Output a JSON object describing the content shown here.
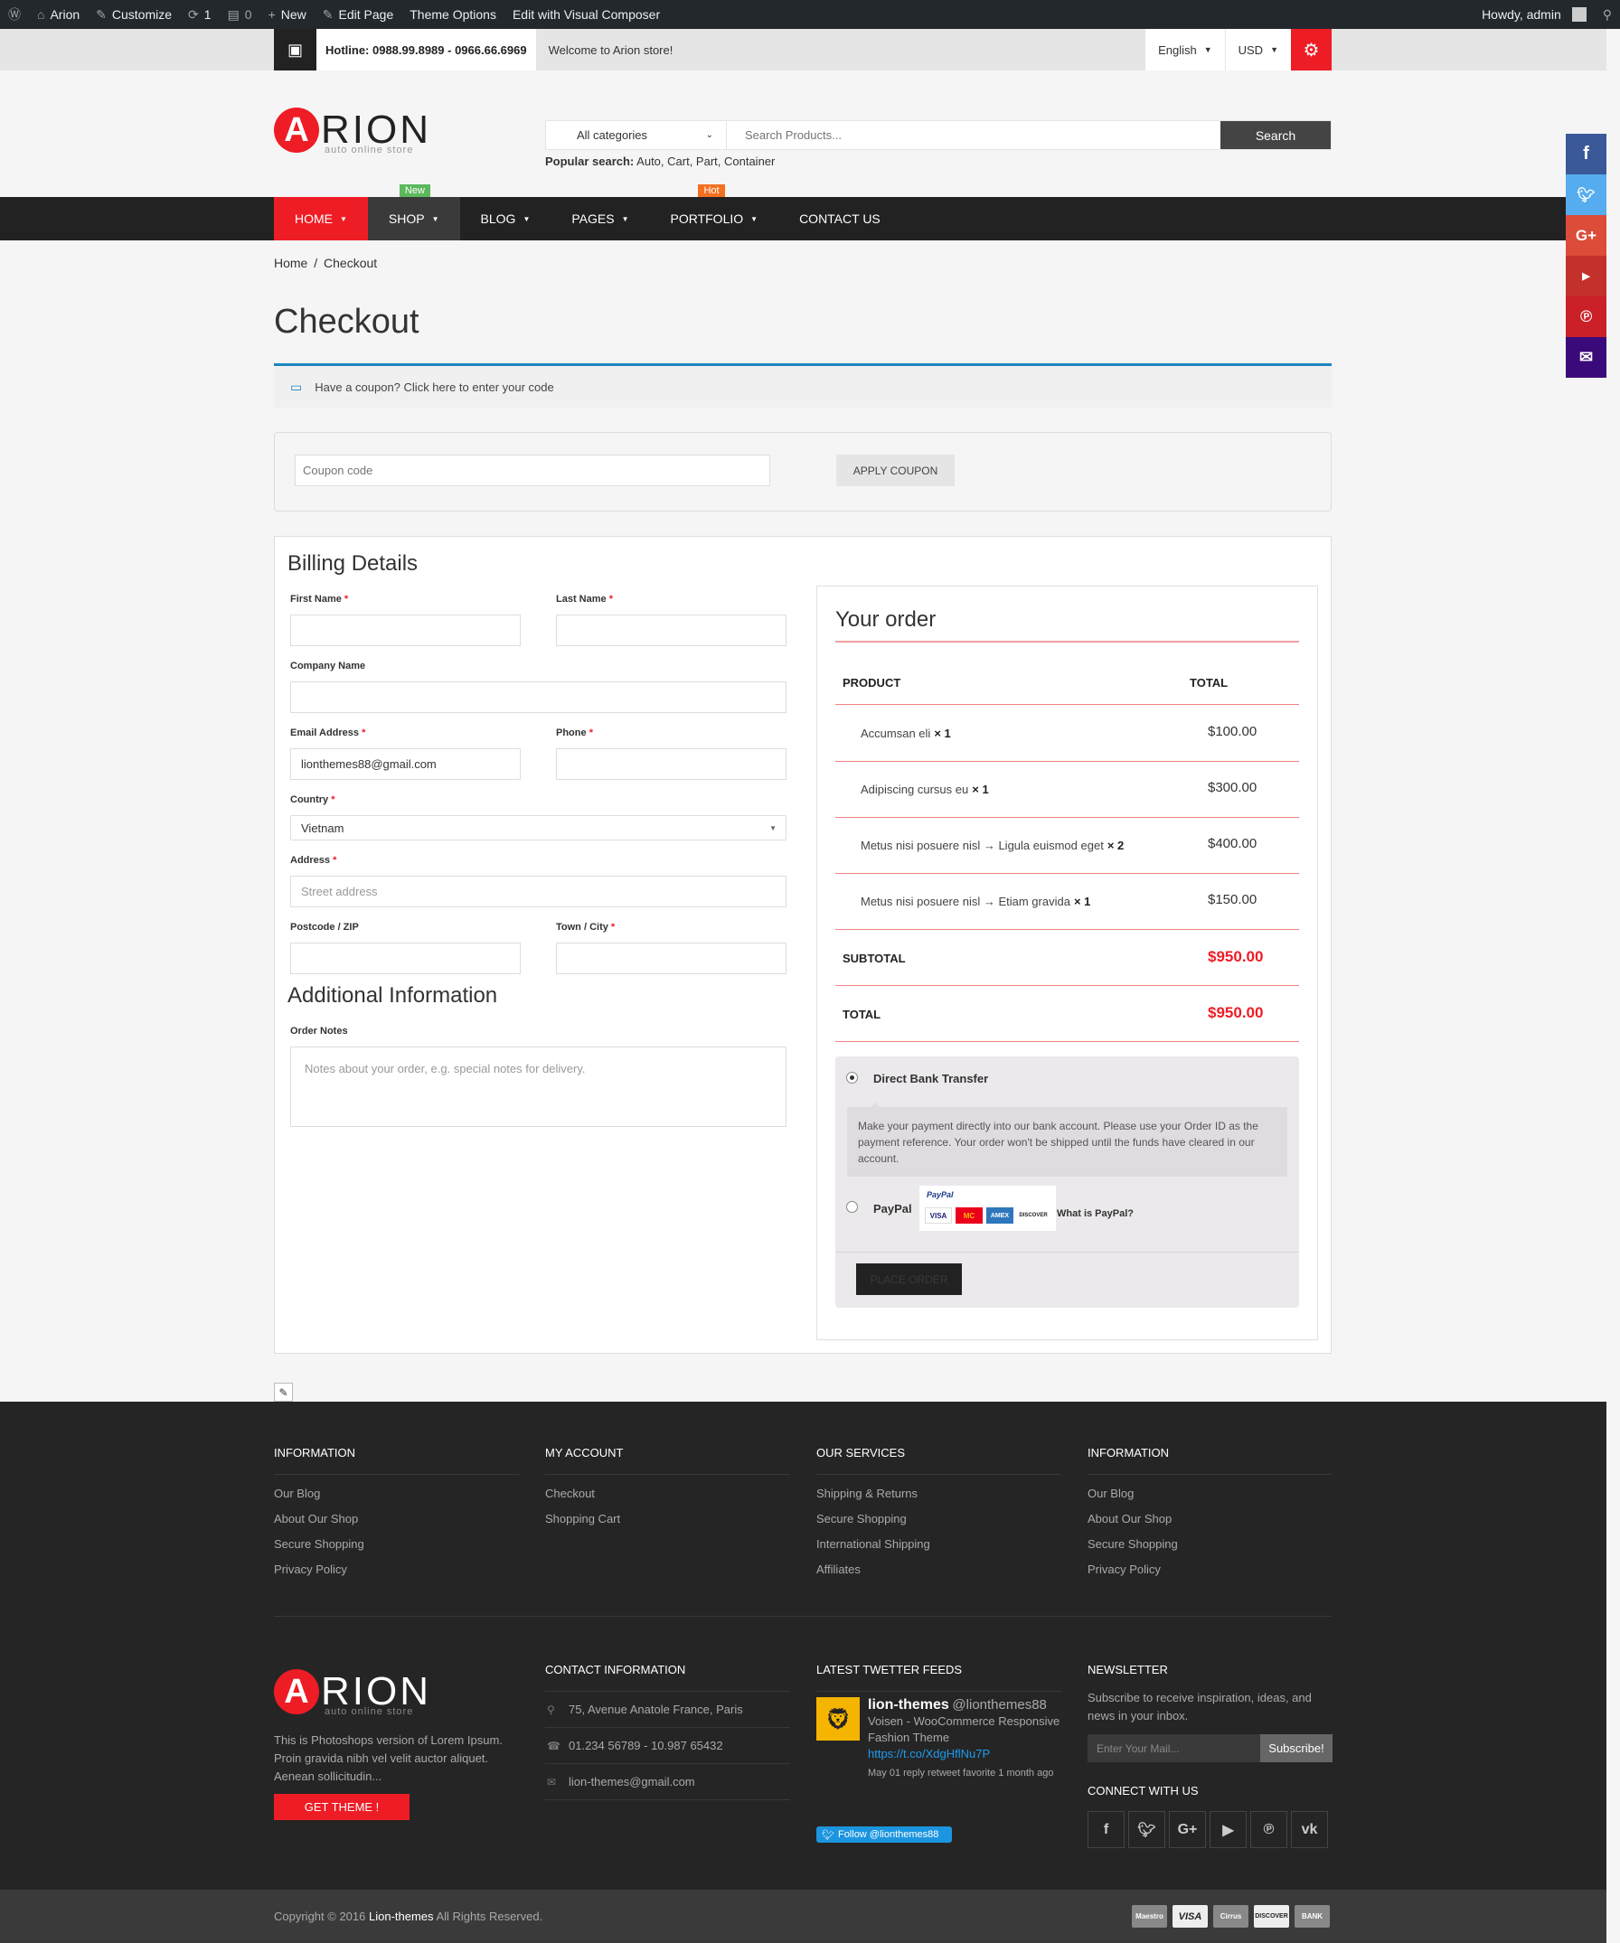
{
  "admin_bar": {
    "site_name": "Arion",
    "customize": "Customize",
    "updates_count": "1",
    "comments_count": "0",
    "new": "New",
    "edit_page": "Edit Page",
    "theme_options": "Theme Options",
    "edit_vc": "Edit with Visual Composer",
    "greeting": "Howdy, admin"
  },
  "topbar": {
    "hotline": "Hotline: 0988.99.8989 - 0966.66.6969",
    "welcome": "Welcome to Arion store!",
    "language": "English",
    "currency": "USD"
  },
  "header": {
    "logo_letter": "A",
    "logo_word": "RION",
    "logo_tagline": "auto online store",
    "search_category": "All categories",
    "search_placeholder": "Search Products...",
    "search_button": "Search",
    "popular_label": "Popular search:",
    "popular_terms": "Auto, Cart, Part, Container"
  },
  "nav": {
    "items": [
      {
        "label": "HOME",
        "badge": ""
      },
      {
        "label": "SHOP",
        "badge": "New"
      },
      {
        "label": "BLOG",
        "badge": ""
      },
      {
        "label": "PAGES",
        "badge": ""
      },
      {
        "label": "PORTFOLIO",
        "badge": "Hot"
      },
      {
        "label": "CONTACT US",
        "badge": ""
      }
    ]
  },
  "breadcrumb": {
    "home": "Home",
    "separator": "/",
    "current": "Checkout"
  },
  "page_title": "Checkout",
  "coupon": {
    "notice": "Have a coupon? Click here to enter your code",
    "placeholder": "Coupon code",
    "button": "APPLY COUPON"
  },
  "billing": {
    "title": "Billing Details",
    "first_name": "First Name",
    "last_name": "Last Name",
    "company": "Company Name",
    "email": "Email Address",
    "email_value": "lionthemes88@gmail.com",
    "phone": "Phone",
    "country": "Country",
    "country_value": "Vietnam",
    "address": "Address",
    "address_placeholder": "Street address",
    "postcode": "Postcode / ZIP",
    "town": "Town / City",
    "required_mark": "*"
  },
  "additional": {
    "title": "Additional Information",
    "notes_label": "Order Notes",
    "notes_placeholder": "Notes about your order, e.g. special notes for delivery."
  },
  "order": {
    "title": "Your order",
    "col_product": "PRODUCT",
    "col_total": "TOTAL",
    "items": [
      {
        "name": "Accumsan eli",
        "qty": "× 1",
        "total": "$100.00"
      },
      {
        "name": "Adipiscing cursus eu",
        "qty": "× 1",
        "total": "$300.00"
      },
      {
        "name": "Metus nisi posuere nisl → Ligula euismod eget",
        "qty": "× 2",
        "total": "$400.00"
      },
      {
        "name": "Metus nisi posuere nisl → Etiam gravida",
        "qty": "× 1",
        "total": "$150.00"
      }
    ],
    "subtotal_label": "SUBTOTAL",
    "subtotal": "$950.00",
    "total_label": "TOTAL",
    "total": "$950.00"
  },
  "payment": {
    "bank_label": "Direct Bank Transfer",
    "bank_desc": "Make your payment directly into our bank account. Please use your Order ID as the payment reference. Your order won't be shipped until the funds have cleared in our account.",
    "paypal_label": "PayPal",
    "paypal_logo_text": "PayPal",
    "what_paypal": "What is PayPal?",
    "place_order": "PLACE ORDER",
    "card_names": [
      "VISA",
      "MC",
      "AMEX",
      "DISCOVER"
    ]
  },
  "footer": {
    "columns": [
      {
        "title": "INFORMATION",
        "links": [
          "Our Blog",
          "About Our Shop",
          "Secure Shopping",
          "Privacy Policy"
        ]
      },
      {
        "title": "MY ACCOUNT",
        "links": [
          "Checkout",
          "Shopping Cart"
        ]
      },
      {
        "title": "OUR SERVICES",
        "links": [
          "Shipping & Returns",
          "Secure Shopping",
          "International Shipping",
          "Affiliates"
        ]
      },
      {
        "title": "INFORMATION",
        "links": [
          "Our Blog",
          "About Our Shop",
          "Secure Shopping",
          "Privacy Policy"
        ]
      }
    ],
    "about": "This is Photoshops version of Lorem Ipsum. Proin gravida nibh vel velit auctor aliquet. Aenean sollicitudin...",
    "get_theme": "GET THEME !",
    "contact_title": "CONTACT INFORMATION",
    "address": "75, Avenue Anatole France, Paris",
    "phone": "01.234 56789 - 10.987 65432",
    "email": "lion-themes@gmail.com",
    "twitter_title": "LATEST TWETTER FEEDS",
    "tweet_name": "lion-themes",
    "tweet_handle": "@lionthemes88",
    "tweet_text": "Voisen - WooCommerce Responsive Fashion Theme",
    "tweet_link": "https://t.co/XdgHflNu7P",
    "tweet_meta": "May 01 reply retweet favorite 1 month ago",
    "follow": "Follow @lionthemes88",
    "newsletter_title": "NEWSLETTER",
    "newsletter_text": "Subscribe to receive inspiration, ideas, and news in your inbox.",
    "newsletter_placeholder": "Enter Your Mail...",
    "newsletter_button": "Subscribe!",
    "connect": "CONNECT WITH US",
    "copyright_pre": "Copyright © 2016",
    "copyright_brand": "Lion-themes",
    "copyright_post": "All Rights Reserved.",
    "payment_cards": [
      "Maestro",
      "VISA",
      "Cirrus",
      "DISCOVER",
      "BANK"
    ]
  },
  "colors": {
    "accent": "#ee1c25",
    "dark": "#222222",
    "footer": "#252525",
    "info_blue": "#1e85be"
  }
}
